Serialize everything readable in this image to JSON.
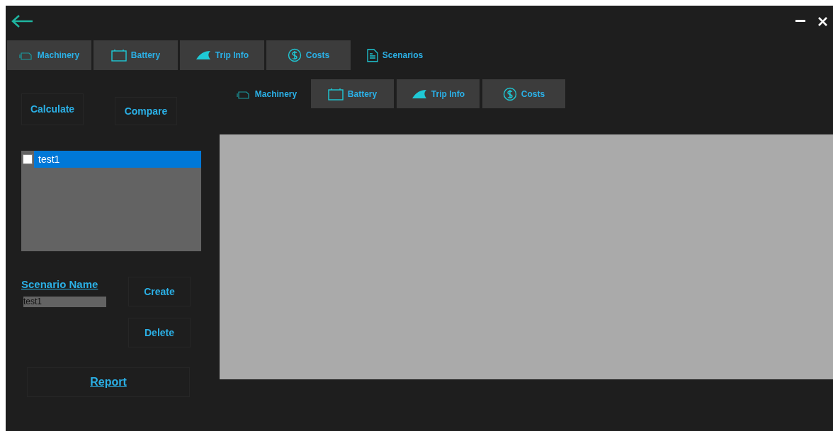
{
  "main_tabs": [
    {
      "label": "Machinery",
      "kind": "engine",
      "selected": false
    },
    {
      "label": "Battery",
      "kind": "battery",
      "selected": false
    },
    {
      "label": "Trip Info",
      "kind": "fin",
      "selected": false
    },
    {
      "label": "Costs",
      "kind": "dollar",
      "selected": false
    },
    {
      "label": "Scenarios",
      "kind": "document",
      "selected": true
    }
  ],
  "actions": {
    "calculate": "Calculate",
    "compare": "Compare"
  },
  "scenario_list": [
    {
      "label": "test1",
      "checked": false,
      "selected": true
    }
  ],
  "scenario_name": {
    "label": "Scenario Name",
    "value": "test1"
  },
  "buttons": {
    "create": "Create",
    "delete": "Delete",
    "report": "Report"
  },
  "sub_tabs": [
    {
      "label": "Machinery",
      "kind": "engine",
      "selected": true
    },
    {
      "label": "Battery",
      "kind": "battery",
      "selected": false
    },
    {
      "label": "Trip Info",
      "kind": "fin",
      "selected": false
    },
    {
      "label": "Costs",
      "kind": "dollar",
      "selected": false
    }
  ]
}
